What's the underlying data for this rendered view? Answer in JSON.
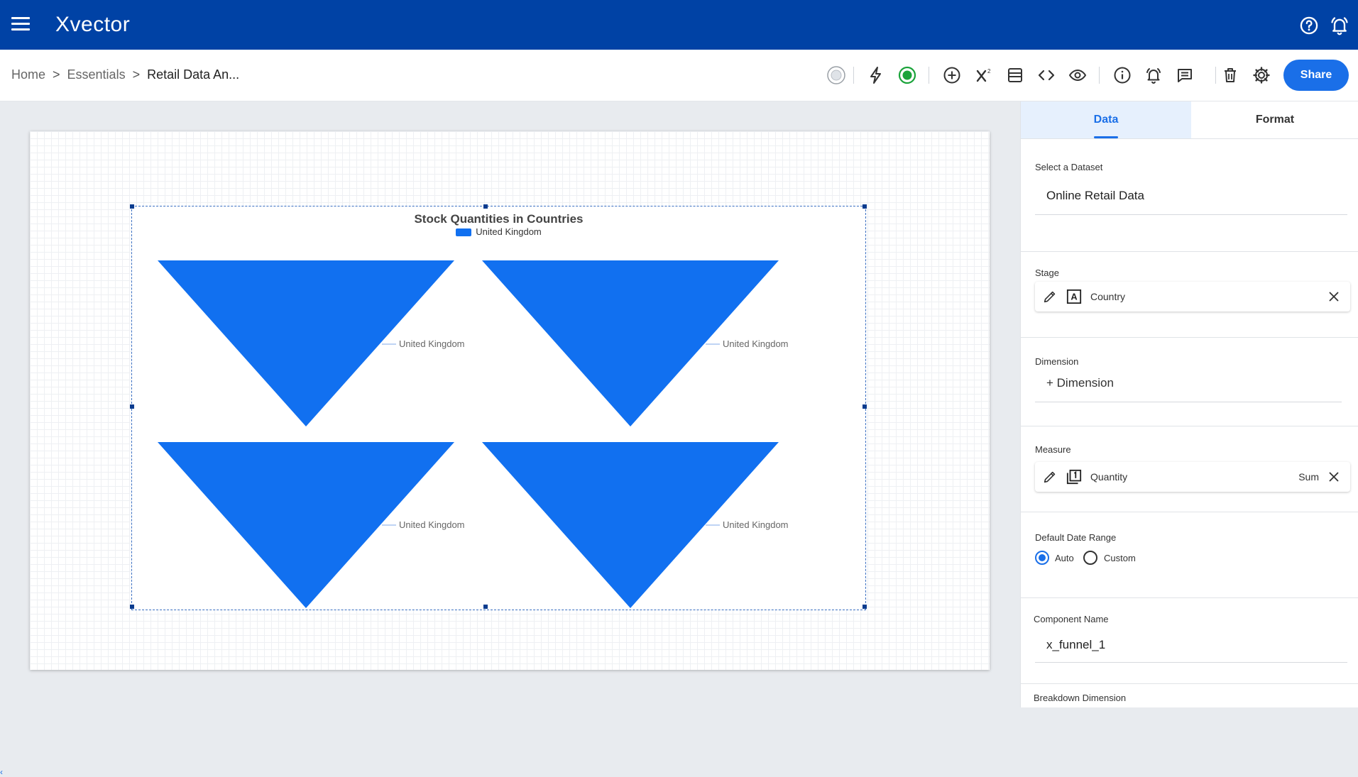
{
  "app": {
    "logo": "Xvector"
  },
  "breadcrumb": {
    "home": "Home",
    "parent": "Essentials",
    "current": "Retail Data An...",
    "separator": ">"
  },
  "toolbar": {
    "share_label": "Share",
    "icons": [
      "status-dot-icon",
      "bolt-icon",
      "live-status-icon",
      "add-circle-icon",
      "formula-icon",
      "panel-icon",
      "code-icon",
      "preview-eye-icon",
      "info-icon",
      "alert-bell-icon",
      "comment-icon",
      "trash-icon",
      "settings-gear-icon"
    ]
  },
  "colors": {
    "brand": "#0042a5",
    "accent": "#1a6fe8",
    "funnel": "#1170f0",
    "live": "#1aa33a"
  },
  "chart": {
    "title": "Stock Quantities in Countries",
    "legend": [
      {
        "label": "United Kingdom"
      }
    ],
    "funnels": [
      {
        "label": "United Kingdom"
      },
      {
        "label": "United Kingdom"
      },
      {
        "label": "United Kingdom"
      },
      {
        "label": "United Kingdom"
      }
    ]
  },
  "panel": {
    "tabs": {
      "data": "Data",
      "format": "Format"
    },
    "dataset": {
      "label": "Select a Dataset",
      "value": "Online Retail Data"
    },
    "stage": {
      "label": "Stage",
      "field": "Country"
    },
    "dimension": {
      "label": "Dimension",
      "add_label": "+ Dimension"
    },
    "measure": {
      "label": "Measure",
      "field": "Quantity",
      "aggregation": "Sum"
    },
    "date_range": {
      "label": "Default Date Range",
      "auto": "Auto",
      "custom": "Custom",
      "selected": "Auto"
    },
    "component": {
      "label": "Component Name",
      "value": "x_funnel_1"
    },
    "breakdown": {
      "label": "Breakdown Dimension"
    }
  }
}
